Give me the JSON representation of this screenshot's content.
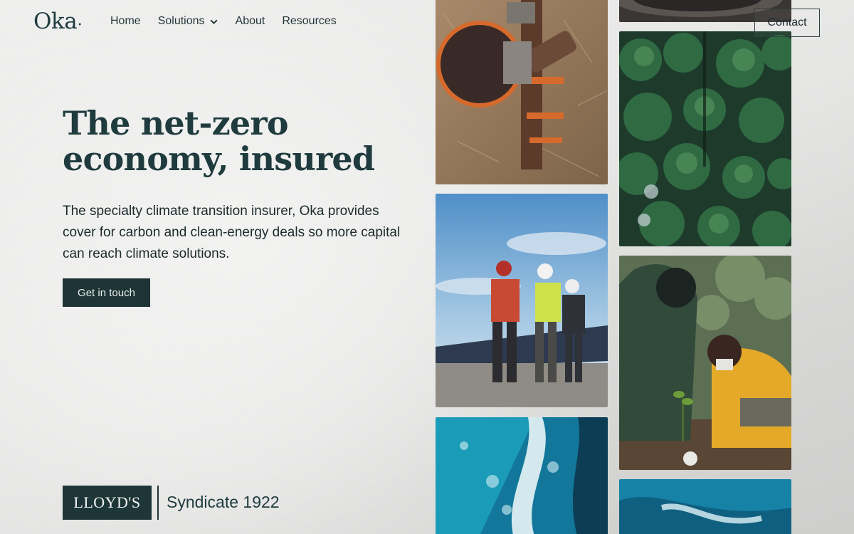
{
  "brand": {
    "logo_text": "Oka"
  },
  "nav": {
    "items": [
      {
        "label": "Home"
      },
      {
        "label": "Solutions",
        "has_dropdown": true
      },
      {
        "label": "About"
      },
      {
        "label": "Resources"
      }
    ],
    "contact_label": "Contact"
  },
  "hero": {
    "title_line1": "The net-zero",
    "title_line2": "economy, insured",
    "subtitle": "The specialty climate transition insurer, Oka provides cover for carbon and clean-energy deals so more capital can reach climate solutions.",
    "cta_label": "Get in touch"
  },
  "partner": {
    "lloyds_text": "LLOYD'S",
    "syndicate_text": "Syndicate 1922"
  },
  "gallery": [
    {
      "icon": "pipeline-photo"
    },
    {
      "icon": "workers-solar-photo"
    },
    {
      "icon": "ocean-waves-photo"
    },
    {
      "icon": "pipe-closeup-photo"
    },
    {
      "icon": "forest-aerial-photo"
    },
    {
      "icon": "tree-planting-photo"
    },
    {
      "icon": "ocean-aerial-photo"
    }
  ],
  "colors": {
    "brand_dark": "#1e3436",
    "text": "#1d2a2c",
    "heading": "#1f3b3e"
  }
}
